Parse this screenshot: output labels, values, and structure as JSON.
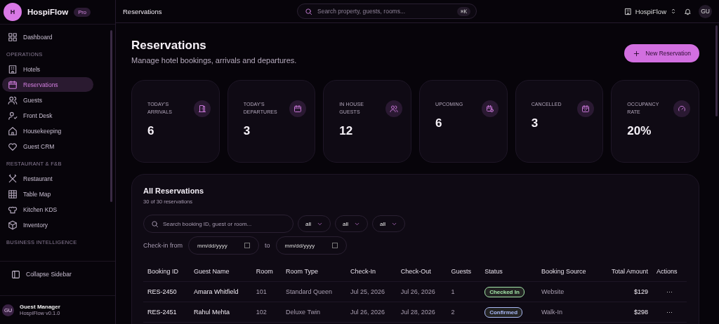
{
  "sidebar": {
    "logo_letter": "H",
    "app_name": "HospiFlow",
    "plan_badge": "Pro",
    "top_items": [
      {
        "label": "Dashboard",
        "selected": false
      }
    ],
    "sections": [
      {
        "title": "OPERATIONS",
        "items": [
          {
            "label": "Hotels",
            "selected": false
          },
          {
            "label": "Reservations",
            "selected": true
          },
          {
            "label": "Guests",
            "selected": false
          },
          {
            "label": "Front Desk",
            "selected": false
          },
          {
            "label": "Housekeeping",
            "selected": false
          },
          {
            "label": "Guest CRM",
            "selected": false
          }
        ]
      },
      {
        "title": "RESTAURANT & F&B",
        "items": [
          {
            "label": "Restaurant",
            "selected": false
          },
          {
            "label": "Table Map",
            "selected": false
          },
          {
            "label": "Kitchen KDS",
            "selected": false
          },
          {
            "label": "Inventory",
            "selected": false
          }
        ]
      },
      {
        "title": "BUSINESS INTELLIGENCE"
      }
    ],
    "collapse_label": "Collapse Sidebar",
    "user": {
      "initials": "GU",
      "name": "Guest Manager",
      "version": "HospiFlow v0.1.0"
    }
  },
  "header": {
    "title": "Reservations",
    "search": {
      "placeholder": "Search property, guests, rooms...",
      "shortcut": "⌘K"
    },
    "property": "HospiFlow",
    "avatar": "GU"
  },
  "page": {
    "title": "Reservations",
    "subtitle": "Manage hotel bookings, arrivals and departures.",
    "new_button": "New Reservation"
  },
  "stats": [
    {
      "label": "TODAY'S ARRIVALS",
      "value": "6"
    },
    {
      "label": "TODAY'S DEPARTURES",
      "value": "3"
    },
    {
      "label": "IN HOUSE GUESTS",
      "value": "12"
    },
    {
      "label": "UPCOMING",
      "value": "6"
    },
    {
      "label": "CANCELLED",
      "value": "3"
    },
    {
      "label": "OCCUPANCY RATE",
      "value": "20%"
    }
  ],
  "reservations": {
    "title": "All Reservations",
    "count": "30 of 30 reservations",
    "search": {
      "placeholder": "Search booking ID, guest or room..."
    },
    "filters": [
      "all",
      "all",
      "all"
    ],
    "date_label": "Check-in from",
    "date_from": "mm/dd/yyyy",
    "date_sep": "to",
    "date_to": "mm/dd/yyyy",
    "columns": [
      "Booking ID",
      "Guest Name",
      "Room",
      "Room Type",
      "Check-In",
      "Check-Out",
      "Guests",
      "Status",
      "Booking Source",
      "Total Amount",
      "Actions"
    ],
    "rows": [
      {
        "id": "RES-2450",
        "guest": "Amara Whitfield",
        "room": "101",
        "room_type": "Standard Queen",
        "check_in": "Jul 25, 2026",
        "check_out": "Jul 26, 2026",
        "guests": "1",
        "status": {
          "label": "Checked In",
          "color": "#a3e6a8"
        },
        "source": "Website",
        "amount": "$129",
        "actions": "···"
      },
      {
        "id": "RES-2451",
        "guest": "Rahul Mehta",
        "room": "102",
        "room_type": "Deluxe Twin",
        "check_in": "Jul 26, 2026",
        "check_out": "Jul 28, 2026",
        "guests": "2",
        "status": {
          "label": "Confirmed",
          "color": "#a9b8f5"
        },
        "source": "Walk-In",
        "amount": "$298",
        "actions": "···"
      }
    ]
  }
}
